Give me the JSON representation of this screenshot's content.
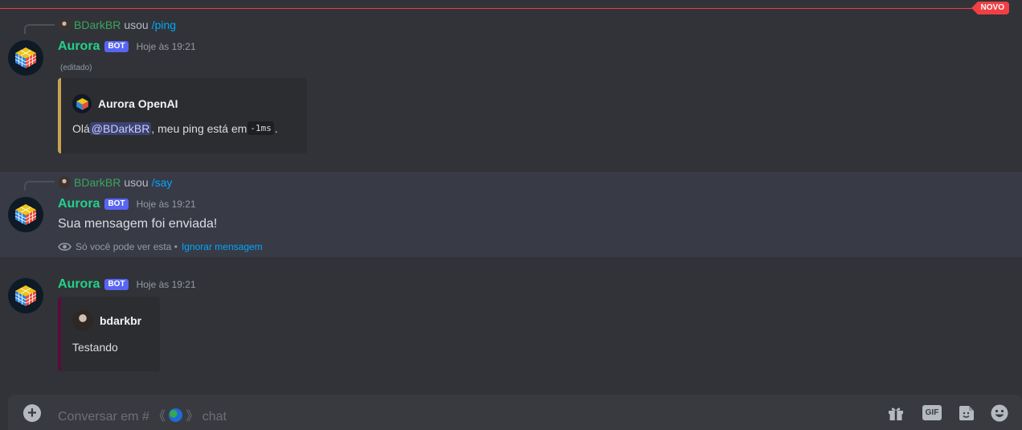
{
  "new_badge": "NOVO",
  "messages": [
    {
      "reply": {
        "user": "BDarkBR",
        "action": "usou",
        "command": "/ping"
      },
      "author": "Aurora",
      "bot_tag": "BOT",
      "time": "Hoje às 19:21",
      "edited": "(editado)",
      "embed": {
        "author": "Aurora OpenAI",
        "text_before": "Olá ",
        "mention": "@BDarkBR",
        "text_middle": ", meu ping está em ",
        "code": "-1ms",
        "text_after": ".",
        "color": "#c9a34e"
      }
    },
    {
      "reply": {
        "user": "BDarkBR",
        "action": "usou",
        "command": "/say"
      },
      "author": "Aurora",
      "bot_tag": "BOT",
      "time": "Hoje às 19:21",
      "content": "Sua mensagem foi enviada!",
      "ephemeral_note": "Só você pode ver esta •",
      "dismiss_link": "Ignorar mensagem"
    },
    {
      "author": "Aurora",
      "bot_tag": "BOT",
      "time": "Hoje às 19:21",
      "embed": {
        "author": "bdarkbr",
        "text": "Testando",
        "color": "#5c0b3f"
      }
    }
  ],
  "composer": {
    "placeholder_prefix": "Conversar em # 《",
    "placeholder_suffix": "》 chat",
    "gif_label": "GIF"
  },
  "icons": [
    "plus-icon",
    "gift-icon",
    "gif-icon",
    "sticker-icon",
    "emoji-icon",
    "eye-icon",
    "globe-icon"
  ],
  "colors": {
    "background": "#313338",
    "bot_name": "#23d18b",
    "bot_tag": "#5865f2",
    "link": "#00a8fc",
    "new_divider": "#f23f43"
  }
}
